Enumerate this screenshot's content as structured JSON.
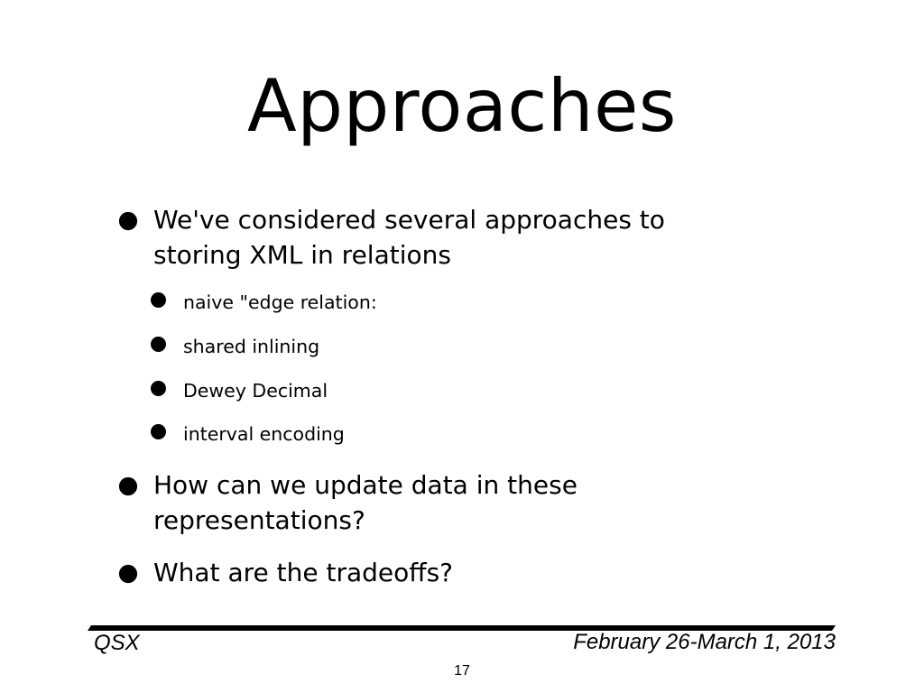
{
  "slide": {
    "title": "Approaches",
    "bullets": [
      {
        "text": "We've considered several approaches to storing XML in relations",
        "line1": "We've considered several approaches to",
        "line2": "storing XML in relations",
        "sub_bullets": [
          "naive \"edge relation:",
          "shared inlining",
          "Dewey Decimal",
          "interval encoding"
        ]
      },
      {
        "text": "How can we update data in these representations?",
        "line1": "How can we update data in these",
        "line2": "representations?"
      },
      {
        "text": "What are the tradeoffs?",
        "line1": "What are the tradeoffs?"
      }
    ]
  },
  "footer": {
    "left": "QSX",
    "right": "February 26-March 1, 2013",
    "page_number": "17"
  }
}
